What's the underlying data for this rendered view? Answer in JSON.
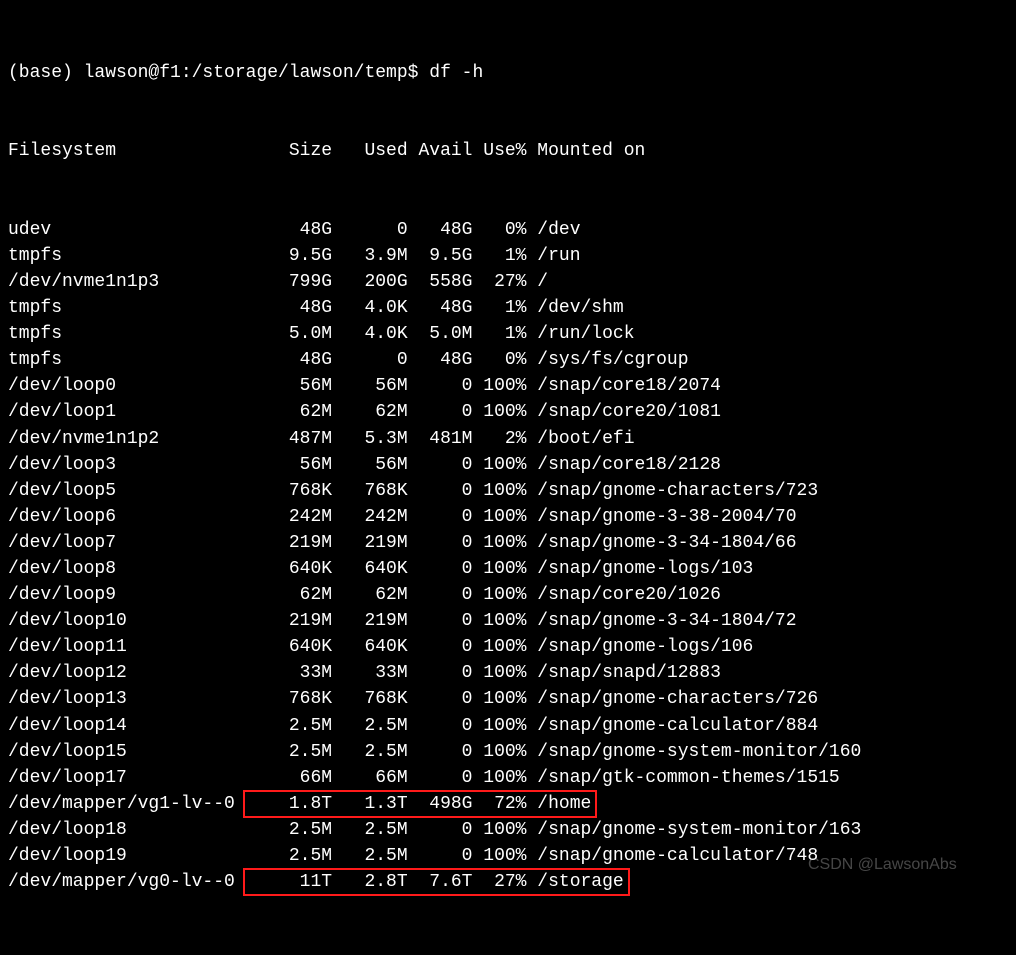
{
  "prompt": "(base) lawson@f1:/storage/lawson/temp$ df -h",
  "header": {
    "filesystem": "Filesystem",
    "size": "Size",
    "used": "Used",
    "avail": "Avail",
    "usep": "Use%",
    "mounted": "Mounted on"
  },
  "rows": [
    {
      "fs": "udev",
      "size": "48G",
      "used": "0",
      "avail": "48G",
      "usep": "0%",
      "mnt": "/dev"
    },
    {
      "fs": "tmpfs",
      "size": "9.5G",
      "used": "3.9M",
      "avail": "9.5G",
      "usep": "1%",
      "mnt": "/run"
    },
    {
      "fs": "/dev/nvme1n1p3",
      "size": "799G",
      "used": "200G",
      "avail": "558G",
      "usep": "27%",
      "mnt": "/"
    },
    {
      "fs": "tmpfs",
      "size": "48G",
      "used": "4.0K",
      "avail": "48G",
      "usep": "1%",
      "mnt": "/dev/shm"
    },
    {
      "fs": "tmpfs",
      "size": "5.0M",
      "used": "4.0K",
      "avail": "5.0M",
      "usep": "1%",
      "mnt": "/run/lock"
    },
    {
      "fs": "tmpfs",
      "size": "48G",
      "used": "0",
      "avail": "48G",
      "usep": "0%",
      "mnt": "/sys/fs/cgroup"
    },
    {
      "fs": "/dev/loop0",
      "size": "56M",
      "used": "56M",
      "avail": "0",
      "usep": "100%",
      "mnt": "/snap/core18/2074"
    },
    {
      "fs": "/dev/loop1",
      "size": "62M",
      "used": "62M",
      "avail": "0",
      "usep": "100%",
      "mnt": "/snap/core20/1081"
    },
    {
      "fs": "/dev/nvme1n1p2",
      "size": "487M",
      "used": "5.3M",
      "avail": "481M",
      "usep": "2%",
      "mnt": "/boot/efi"
    },
    {
      "fs": "/dev/loop3",
      "size": "56M",
      "used": "56M",
      "avail": "0",
      "usep": "100%",
      "mnt": "/snap/core18/2128"
    },
    {
      "fs": "/dev/loop5",
      "size": "768K",
      "used": "768K",
      "avail": "0",
      "usep": "100%",
      "mnt": "/snap/gnome-characters/723"
    },
    {
      "fs": "/dev/loop6",
      "size": "242M",
      "used": "242M",
      "avail": "0",
      "usep": "100%",
      "mnt": "/snap/gnome-3-38-2004/70"
    },
    {
      "fs": "/dev/loop7",
      "size": "219M",
      "used": "219M",
      "avail": "0",
      "usep": "100%",
      "mnt": "/snap/gnome-3-34-1804/66"
    },
    {
      "fs": "/dev/loop8",
      "size": "640K",
      "used": "640K",
      "avail": "0",
      "usep": "100%",
      "mnt": "/snap/gnome-logs/103"
    },
    {
      "fs": "/dev/loop9",
      "size": "62M",
      "used": "62M",
      "avail": "0",
      "usep": "100%",
      "mnt": "/snap/core20/1026"
    },
    {
      "fs": "/dev/loop10",
      "size": "219M",
      "used": "219M",
      "avail": "0",
      "usep": "100%",
      "mnt": "/snap/gnome-3-34-1804/72"
    },
    {
      "fs": "/dev/loop11",
      "size": "640K",
      "used": "640K",
      "avail": "0",
      "usep": "100%",
      "mnt": "/snap/gnome-logs/106"
    },
    {
      "fs": "/dev/loop12",
      "size": "33M",
      "used": "33M",
      "avail": "0",
      "usep": "100%",
      "mnt": "/snap/snapd/12883"
    },
    {
      "fs": "/dev/loop13",
      "size": "768K",
      "used": "768K",
      "avail": "0",
      "usep": "100%",
      "mnt": "/snap/gnome-characters/726"
    },
    {
      "fs": "/dev/loop14",
      "size": "2.5M",
      "used": "2.5M",
      "avail": "0",
      "usep": "100%",
      "mnt": "/snap/gnome-calculator/884"
    },
    {
      "fs": "/dev/loop15",
      "size": "2.5M",
      "used": "2.5M",
      "avail": "0",
      "usep": "100%",
      "mnt": "/snap/gnome-system-monitor/160"
    },
    {
      "fs": "/dev/loop17",
      "size": "66M",
      "used": "66M",
      "avail": "0",
      "usep": "100%",
      "mnt": "/snap/gtk-common-themes/1515"
    },
    {
      "fs": "/dev/mapper/vg1-lv--0",
      "size": "1.8T",
      "used": "1.3T",
      "avail": "498G",
      "usep": "72%",
      "mnt": "/home"
    },
    {
      "fs": "/dev/loop18",
      "size": "2.5M",
      "used": "2.5M",
      "avail": "0",
      "usep": "100%",
      "mnt": "/snap/gnome-system-monitor/163"
    },
    {
      "fs": "/dev/loop19",
      "size": "2.5M",
      "used": "2.5M",
      "avail": "0",
      "usep": "100%",
      "mnt": "/snap/gnome-calculator/748"
    },
    {
      "fs": "/dev/mapper/vg0-lv--0",
      "size": "11T",
      "used": "2.8T",
      "avail": "7.6T",
      "usep": "27%",
      "mnt": "/storage"
    }
  ],
  "highlights": [
    {
      "row_index": 22
    },
    {
      "row_index": 25
    }
  ],
  "watermark": "CSDN @LawsonAbs",
  "col_widths": {
    "fs": 22,
    "size": 8,
    "used": 7,
    "avail": 6,
    "usep": 5
  }
}
